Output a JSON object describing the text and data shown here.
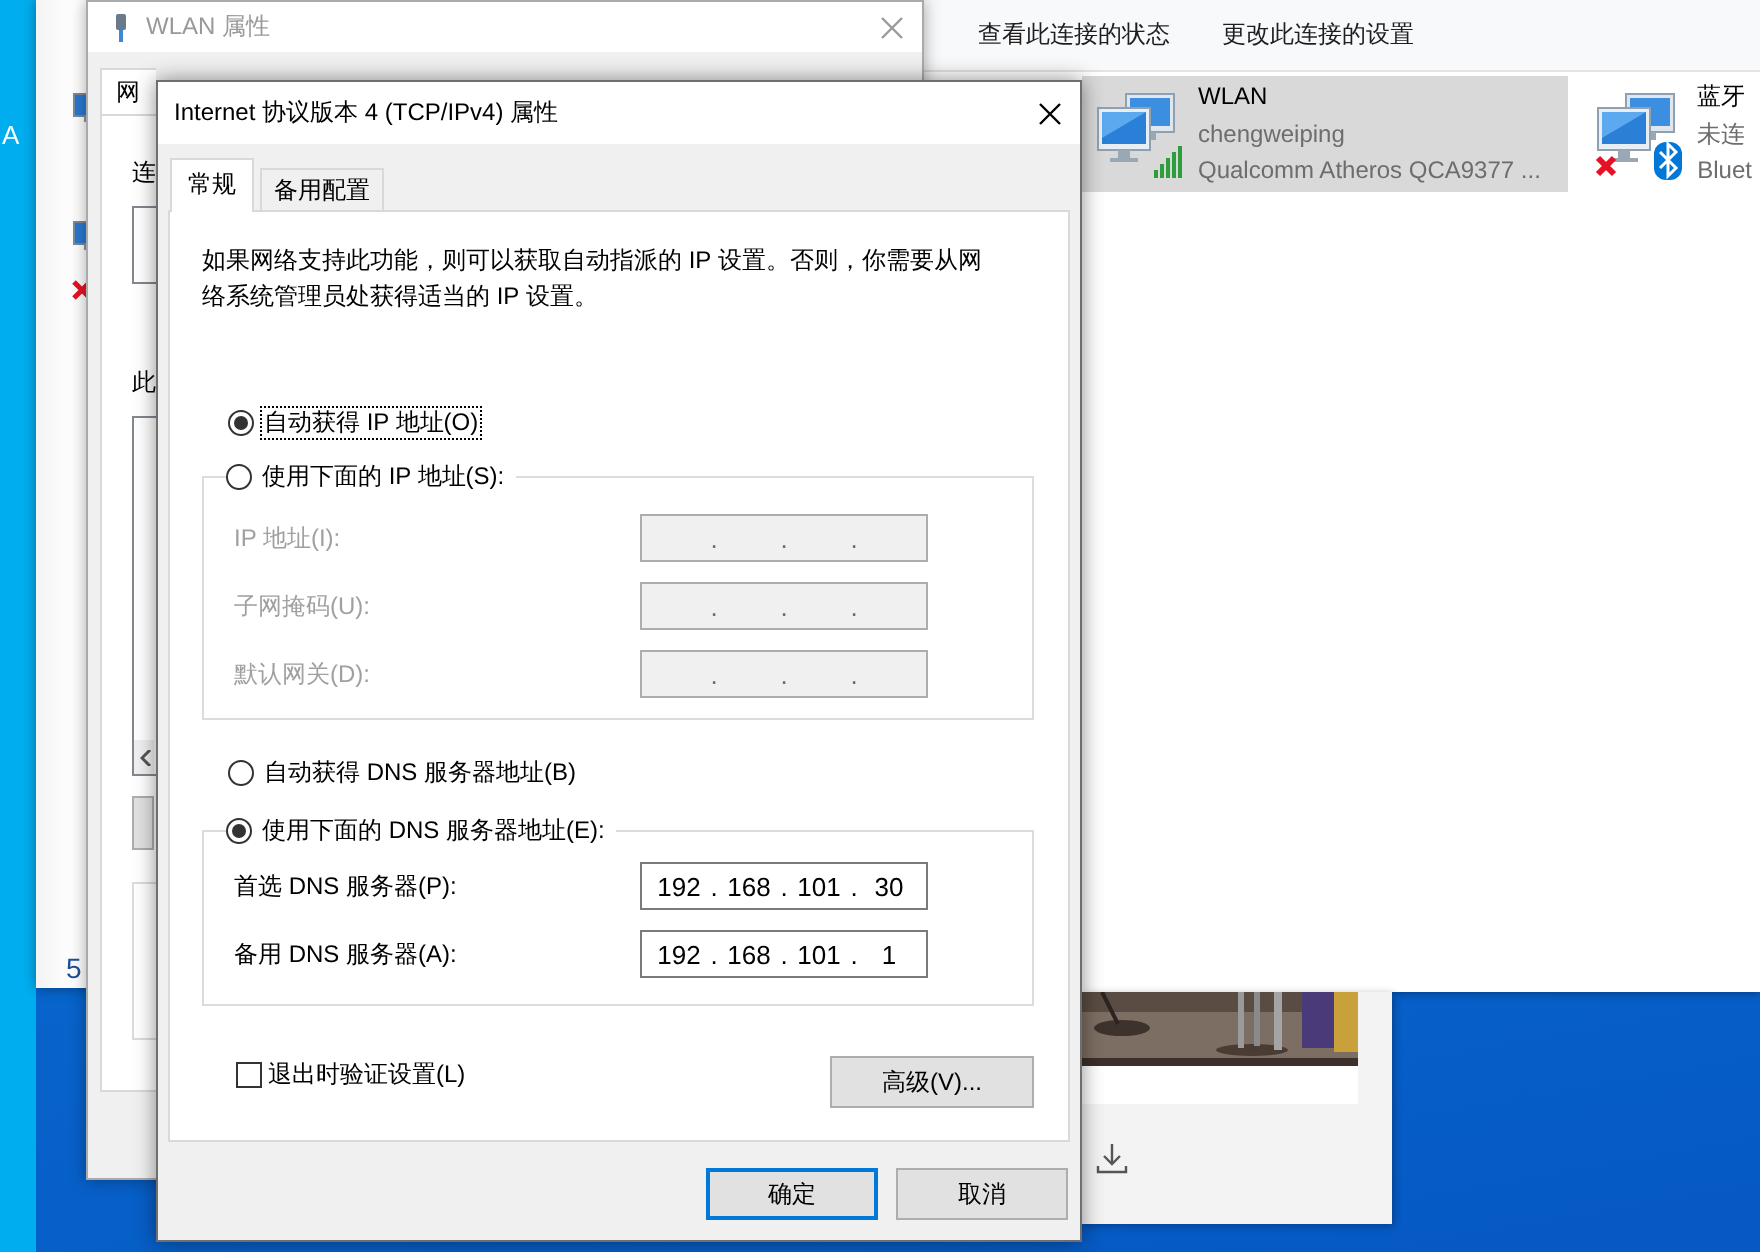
{
  "desktop": {
    "labels": [
      "A"
    ]
  },
  "back_window": {
    "text": "5"
  },
  "wlan_properties": {
    "title": "WLAN 属性",
    "tabs": [
      {
        "label": "网",
        "selected": true
      }
    ],
    "labels": [
      "连",
      "此"
    ]
  },
  "network_connections": {
    "toolbar": [
      {
        "label": "查看此连接的状态"
      },
      {
        "label": "更改此连接的设置"
      }
    ],
    "connections": [
      {
        "kind": "wifi",
        "name": "WLAN",
        "status": "chengweiping",
        "device": "Qualcomm Atheros QCA9377 ...",
        "selected": true,
        "error": false
      },
      {
        "kind": "bluetooth",
        "name": "蓝牙",
        "status": "未连",
        "device": "Bluet",
        "selected": false,
        "error": true
      }
    ]
  },
  "dialog": {
    "title": "Internet 协议版本 4 (TCP/IPv4) 属性",
    "tabs": [
      {
        "label": "常规",
        "selected": true
      },
      {
        "label": "备用配置",
        "selected": false
      }
    ],
    "description": "如果网络支持此功能，则可以获取自动指派的 IP 设置。否则，你需要从网络系统管理员处获得适当的 IP 设置。",
    "ip_options": [
      {
        "label": "自动获得 IP 地址(O)",
        "selected": true,
        "focused": true
      },
      {
        "label": "使用下面的 IP 地址(S):",
        "selected": false,
        "focused": false
      }
    ],
    "ip_fields": {
      "disabled": true,
      "rows": [
        {
          "label": "IP 地址(I):",
          "separators": [
            ".",
            ".",
            "."
          ]
        },
        {
          "label": "子网掩码(U):",
          "separators": [
            ".",
            ".",
            "."
          ]
        },
        {
          "label": "默认网关(D):",
          "separators": [
            ".",
            ".",
            "."
          ]
        }
      ]
    },
    "dns_options": [
      {
        "label": "自动获得 DNS 服务器地址(B)",
        "selected": false,
        "focused": false
      },
      {
        "label": "使用下面的 DNS 服务器地址(E):",
        "selected": true,
        "focused": false
      }
    ],
    "dns_fields": {
      "disabled": false,
      "rows": [
        {
          "label": "首选 DNS 服务器(P):",
          "octets": [
            "192",
            "168",
            "101",
            "30"
          ],
          "separators": [
            ".",
            ".",
            "."
          ]
        },
        {
          "label": "备用 DNS 服务器(A):",
          "octets": [
            "192",
            "168",
            "101",
            "1"
          ],
          "separators": [
            ".",
            ".",
            "."
          ]
        }
      ]
    },
    "validate": {
      "label": "退出时验证设置(L)",
      "checked": false
    },
    "advanced_button": "高级(V)...",
    "buttons": [
      {
        "label": "确定",
        "default": true
      },
      {
        "label": "取消",
        "default": false
      }
    ]
  }
}
